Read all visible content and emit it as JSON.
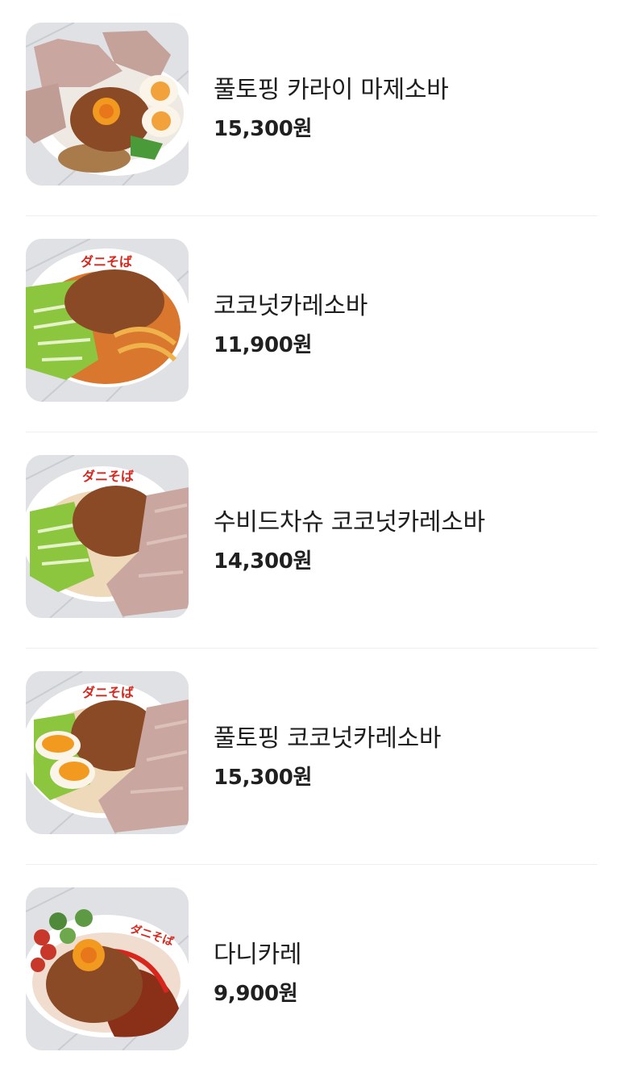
{
  "menu": {
    "items": [
      {
        "name": "풀토핑 카라이 마제소바",
        "price": "15,300원",
        "image": "mazesoba-full-topping-photo"
      },
      {
        "name": "코코넛카레소바",
        "price": "11,900원",
        "image": "coconut-curry-soba-photo"
      },
      {
        "name": "수비드차슈 코코넛카레소바",
        "price": "14,300원",
        "image": "sous-vide-chashu-coconut-curry-soba-photo"
      },
      {
        "name": "풀토핑 코코넛카레소바",
        "price": "15,300원",
        "image": "full-topping-coconut-curry-soba-photo"
      },
      {
        "name": "다니카레",
        "price": "9,900원",
        "image": "dani-curry-photo"
      }
    ]
  },
  "colors": {
    "text": "#1e1e1e",
    "divider": "#eeeeee",
    "bowl": "#ffffff",
    "meat_sauce": "#8a4a26",
    "curry_broth": "#d9772e",
    "scallion": "#8cc63f",
    "chashu": "#c9a7a0",
    "egg_yolk": "#f29a1f",
    "logo_red": "#d9261c"
  }
}
